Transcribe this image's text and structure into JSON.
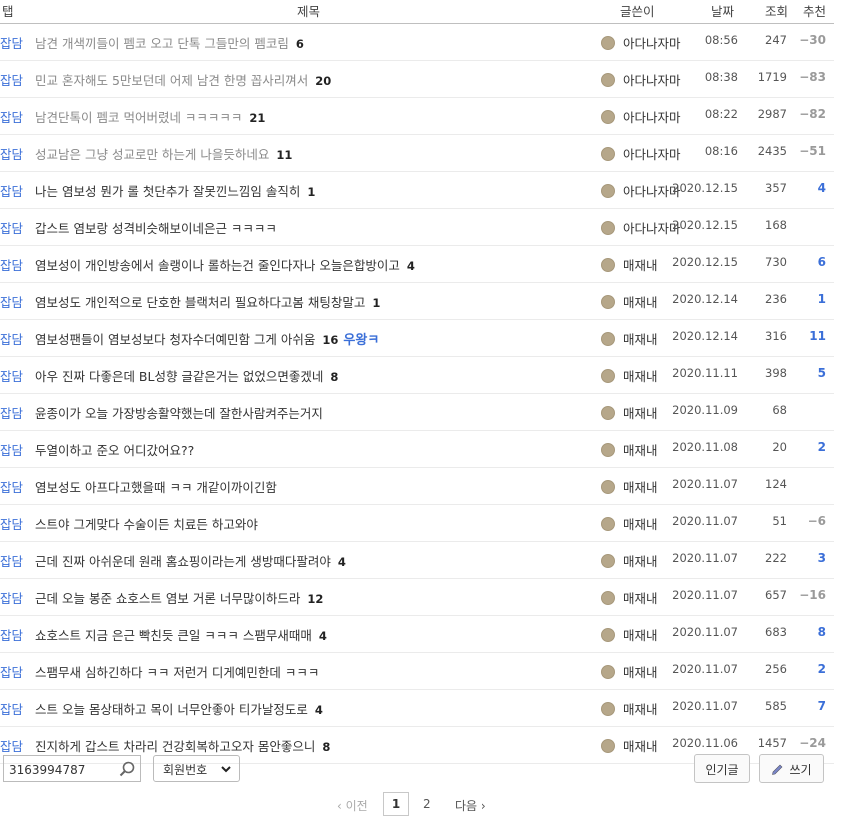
{
  "header": {
    "tab": "탭",
    "title": "제목",
    "author": "글쓴이",
    "date": "날짜",
    "views": "조회",
    "rec": "추천"
  },
  "rows": [
    {
      "tab": "잡담",
      "title": "남견 개색끼들이 펨코 오고 단톡 그들만의 펨코림",
      "comments": "6",
      "author": "아다나자마",
      "date": "08:56",
      "views": "247",
      "rec": "−30",
      "old": true
    },
    {
      "tab": "잡담",
      "title": "민교 혼자해도 5만보던데 어제 남견 한명 꼽사리껴서",
      "comments": "20",
      "author": "아다나자마",
      "date": "08:38",
      "views": "1719",
      "rec": "−83",
      "old": true
    },
    {
      "tab": "잡담",
      "title": "남견단톡이 펨코 먹어버렸네 ㅋㅋㅋㅋㅋ",
      "comments": "21",
      "author": "아다나자마",
      "date": "08:22",
      "views": "2987",
      "rec": "−82",
      "old": true
    },
    {
      "tab": "잡담",
      "title": "성교남은 그냥 성교로만 하는게 나을듯하네요",
      "comments": "11",
      "author": "아다나자마",
      "date": "08:16",
      "views": "2435",
      "rec": "−51",
      "old": true
    },
    {
      "tab": "잡담",
      "title": "나는 염보성 뭔가 롤 첫단추가 잘못낀느낌임 솔직히",
      "comments": "1",
      "author": "아다나자마",
      "date": "2020.12.15",
      "views": "357",
      "rec": "4"
    },
    {
      "tab": "잡담",
      "title": "갑스트 염보랑 성격비슷해보이네은근 ㅋㅋㅋㅋ",
      "comments": "",
      "author": "아다나자마",
      "date": "2020.12.15",
      "views": "168",
      "rec": ""
    },
    {
      "tab": "잡담",
      "title": "염보성이 개인방송에서 솔랭이나 롤하는건 줄인다자나 오늘은합방이고",
      "comments": "4",
      "author": "매재내",
      "date": "2020.12.15",
      "views": "730",
      "rec": "6"
    },
    {
      "tab": "잡담",
      "title": "염보성도 개인적으로 단호한 블랙처리 필요하다고봄 채팅창말고",
      "comments": "1",
      "author": "매재내",
      "date": "2020.12.14",
      "views": "236",
      "rec": "1"
    },
    {
      "tab": "잡담",
      "title": "염보성팬들이 염보성보다 청자수더예민함 그게 아쉬움",
      "comments": "16",
      "badge": "우왕ㅋ",
      "author": "매재내",
      "date": "2020.12.14",
      "views": "316",
      "rec": "11"
    },
    {
      "tab": "잡담",
      "title": "아우 진짜 다좋은데 BL성향 글같은거는 없었으면좋겠네",
      "comments": "8",
      "author": "매재내",
      "date": "2020.11.11",
      "views": "398",
      "rec": "5"
    },
    {
      "tab": "잡담",
      "title": "윤종이가 오늘 가장방송활약했는데 잘한사람켜주는거지",
      "comments": "",
      "author": "매재내",
      "date": "2020.11.09",
      "views": "68",
      "rec": ""
    },
    {
      "tab": "잡담",
      "title": "두열이하고 준오 어디갔어요??",
      "comments": "",
      "author": "매재내",
      "date": "2020.11.08",
      "views": "20",
      "rec": "2"
    },
    {
      "tab": "잡담",
      "title": "염보성도 아프다고했을때 ㅋㅋ 개같이까이긴함",
      "comments": "",
      "author": "매재내",
      "date": "2020.11.07",
      "views": "124",
      "rec": ""
    },
    {
      "tab": "잡담",
      "title": "스트야 그게맞다 수술이든 치료든 하고와야",
      "comments": "",
      "author": "매재내",
      "date": "2020.11.07",
      "views": "51",
      "rec": "−6"
    },
    {
      "tab": "잡담",
      "title": "근데 진짜 아쉬운데 원래 홈쇼핑이라는게 생방때다팔려야",
      "comments": "4",
      "author": "매재내",
      "date": "2020.11.07",
      "views": "222",
      "rec": "3"
    },
    {
      "tab": "잡담",
      "title": "근데 오늘 봉준 쇼호스트 염보 거론 너무많이하드라",
      "comments": "12",
      "author": "매재내",
      "date": "2020.11.07",
      "views": "657",
      "rec": "−16"
    },
    {
      "tab": "잡담",
      "title": "쇼호스트 지금 은근 빡친듯 큰일 ㅋㅋㅋ 스팸무새때매",
      "comments": "4",
      "author": "매재내",
      "date": "2020.11.07",
      "views": "683",
      "rec": "8"
    },
    {
      "tab": "잡담",
      "title": "스팸무새 심하긴하다 ㅋㅋ 저런거 디게예민한데 ㅋㅋㅋ",
      "comments": "",
      "author": "매재내",
      "date": "2020.11.07",
      "views": "256",
      "rec": "2"
    },
    {
      "tab": "잡담",
      "title": "스트 오늘 몸상태하고 목이 너무안좋아 티가날정도로",
      "comments": "4",
      "author": "매재내",
      "date": "2020.11.07",
      "views": "585",
      "rec": "7"
    },
    {
      "tab": "잡담",
      "title": "진지하게 갑스트 차라리 건강회복하고오자 몸안좋으니",
      "comments": "8",
      "author": "매재내",
      "date": "2020.11.06",
      "views": "1457",
      "rec": "−24"
    }
  ],
  "search": {
    "value": "3163994787",
    "select": "회원번호"
  },
  "buttons": {
    "popular": "인기글",
    "write": "쓰기"
  },
  "pager": {
    "prev": "‹ 이전",
    "pages": [
      "1",
      "2"
    ],
    "next": "다음 ›"
  },
  "colors": {
    "link": "#3b6fd8",
    "muted": "#8a8a8a",
    "avatar": "#b6a78a"
  }
}
